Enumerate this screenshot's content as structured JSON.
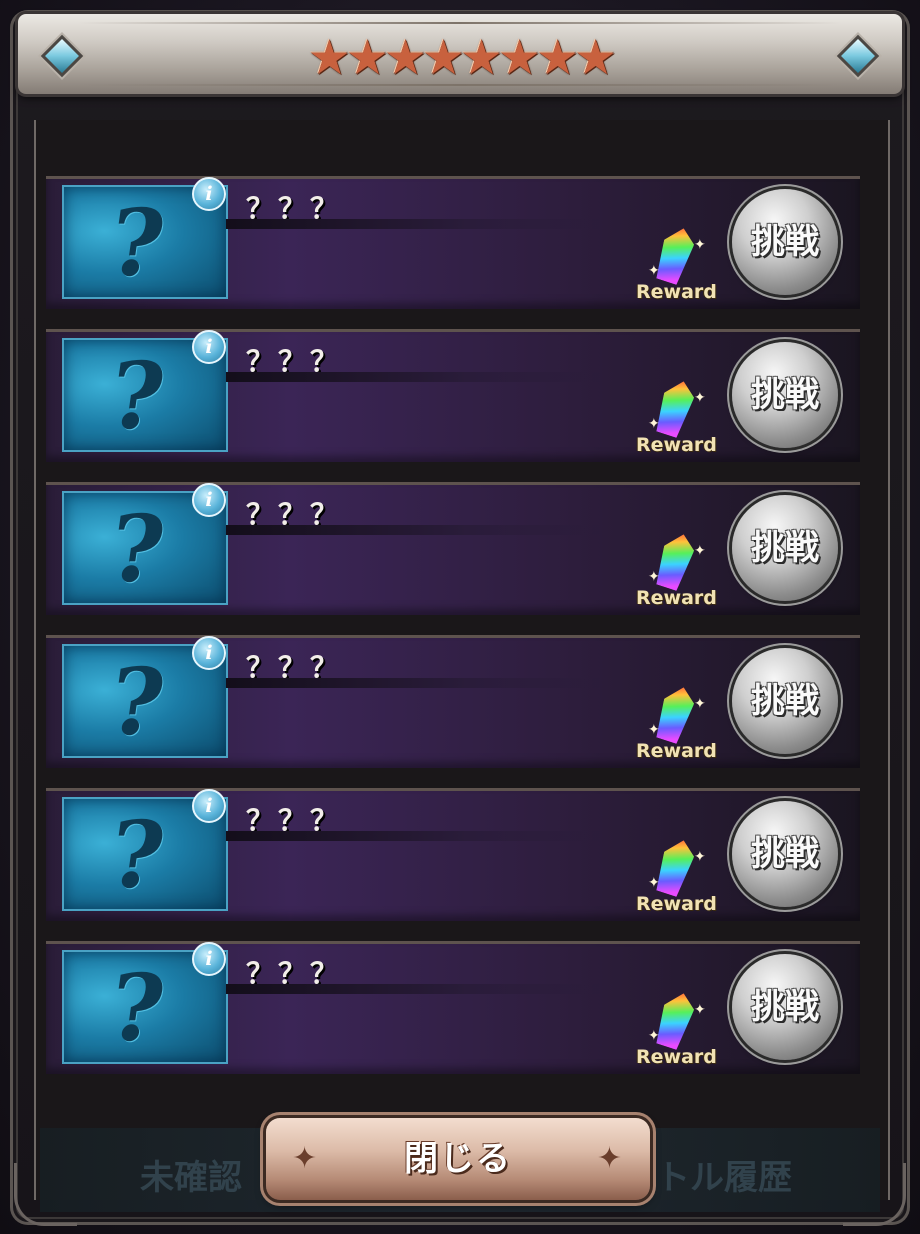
{
  "header": {
    "stars": "★★★★★★★★"
  },
  "footer": {
    "close_label": "閉じる",
    "ghost_left": "未確認",
    "ghost_right": "トル履歴"
  },
  "quests": [
    {
      "name": "？？？",
      "reward_label": "Reward",
      "challenge_label": "挑戦",
      "info_glyph": "i",
      "thumb_glyph": "?"
    },
    {
      "name": "？？？",
      "reward_label": "Reward",
      "challenge_label": "挑戦",
      "info_glyph": "i",
      "thumb_glyph": "?"
    },
    {
      "name": "？？？",
      "reward_label": "Reward",
      "challenge_label": "挑戦",
      "info_glyph": "i",
      "thumb_glyph": "?"
    },
    {
      "name": "？？？",
      "reward_label": "Reward",
      "challenge_label": "挑戦",
      "info_glyph": "i",
      "thumb_glyph": "?"
    },
    {
      "name": "？？？",
      "reward_label": "Reward",
      "challenge_label": "挑戦",
      "info_glyph": "i",
      "thumb_glyph": "?"
    },
    {
      "name": "？？？",
      "reward_label": "Reward",
      "challenge_label": "挑戦",
      "info_glyph": "i",
      "thumb_glyph": "?"
    }
  ],
  "icons": {
    "header_gems": "diamond-gem-icon",
    "quest_thumbnail": "unknown-quest-icon",
    "info": "info-icon",
    "reward": "rainbow-crystal-icon"
  }
}
